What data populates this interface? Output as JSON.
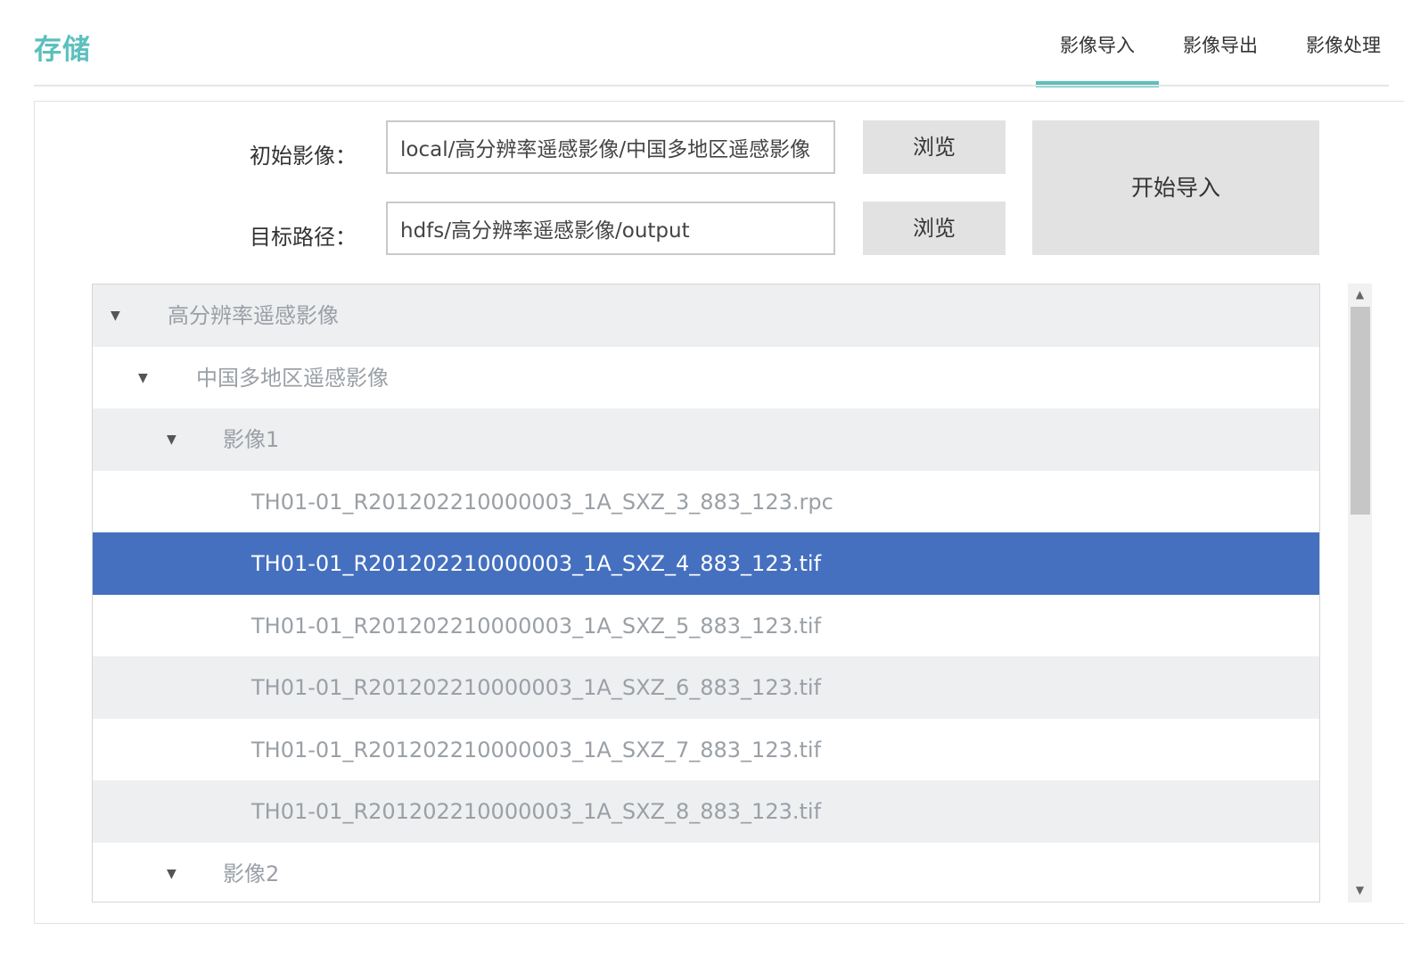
{
  "brand": "存储",
  "tabs": [
    {
      "label": "影像导入",
      "active": true
    },
    {
      "label": "影像导出",
      "active": false
    },
    {
      "label": "影像处理",
      "active": false
    }
  ],
  "form": {
    "source_label": "初始影像：",
    "source_value": "local/高分辨率遥感影像/中国多地区遥感影像",
    "target_label": "目标路径：",
    "target_value": "hdfs/高分辨率遥感影像/output",
    "browse_label": "浏览",
    "start_label": "开始导入"
  },
  "tree": [
    {
      "level": 0,
      "label": "高分辨率遥感影像",
      "expanded": true
    },
    {
      "level": 1,
      "label": "中国多地区遥感影像",
      "expanded": true
    },
    {
      "level": 2,
      "label": "影像1",
      "expanded": true
    },
    {
      "level": 3,
      "label": "TH01-01_R201202210000003_1A_SXZ_3_883_123.rpc"
    },
    {
      "level": 3,
      "label": "TH01-01_R201202210000003_1A_SXZ_4_883_123.tif",
      "selected": true
    },
    {
      "level": 3,
      "label": "TH01-01_R201202210000003_1A_SXZ_5_883_123.tif"
    },
    {
      "level": 3,
      "label": "TH01-01_R201202210000003_1A_SXZ_6_883_123.tif"
    },
    {
      "level": 3,
      "label": "TH01-01_R201202210000003_1A_SXZ_7_883_123.tif"
    },
    {
      "level": 3,
      "label": "TH01-01_R201202210000003_1A_SXZ_8_883_123.tif"
    },
    {
      "level": 2,
      "label": "影像2",
      "expanded": true
    }
  ],
  "colors": {
    "accent": "#5cc0bd",
    "selected_row": "#4570c0",
    "alt_row": "#eeeff1"
  }
}
